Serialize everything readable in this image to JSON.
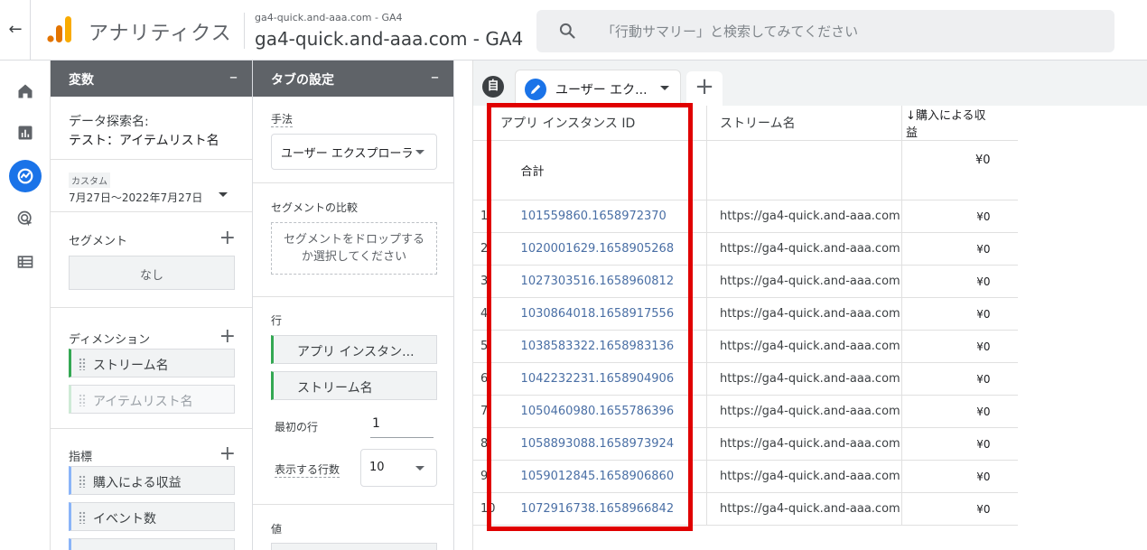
{
  "header": {
    "app_name": "アナリティクス",
    "account_line": "ga4-quick.and-aaa.com - GA4",
    "property_name": "ga4-quick.and-aaa.com - GA4",
    "search_placeholder": "「行動サマリー」と検索してみてください",
    "icons": [
      "back-arrow-icon",
      "analytics-logo",
      "search-icon"
    ]
  },
  "rail": {
    "items": [
      "home-icon",
      "reports-icon",
      "explore-icon",
      "advertising-icon",
      "configure-icon"
    ],
    "active": "explore-icon",
    "accent": "#1a73e8"
  },
  "variables": {
    "title": "変数",
    "collapse": "–",
    "exploration_label": "データ探索名:",
    "exploration_name": "テスト：アイテムリスト名",
    "date_badge": "カスタム",
    "date_range": "7月27日～2022年7月27日",
    "segments_title": "セグメント",
    "segments_empty": "なし",
    "dimensions_title": "ディメンション",
    "dimensions": [
      "ストリーム名",
      "アイテムリスト名"
    ],
    "metrics_title": "指標",
    "metrics": [
      "購入による収益",
      "イベント数"
    ],
    "add": "+"
  },
  "tab_settings": {
    "title": "タブの設定",
    "collapse": "–",
    "technique_label": "手法",
    "technique_value": "ユーザー エクスプローラ",
    "segment_compare_label": "セグメントの比較",
    "segment_drop_text": "セグメントをドロップするか選択してください",
    "rows_label": "行",
    "rows": [
      "アプリ インスタン...",
      "ストリーム名"
    ],
    "first_row_label": "最初の行",
    "first_row_value": "1",
    "rows_shown_label": "表示する行数",
    "rows_shown_value": "10",
    "values_label": "値"
  },
  "tabs": {
    "auto_badge": "自",
    "active_label": "ユーザー エク...",
    "add": "+"
  },
  "table": {
    "columns": [
      "アプリ インスタンス ID",
      "ストリーム名",
      "↓購入による収益"
    ],
    "total_label": "合計",
    "total_revenue": "¥0",
    "rows": [
      {
        "idx": "1",
        "id": "101559860.1658972370",
        "stream": "https://ga4-quick.and-aaa.com",
        "revenue": "¥0"
      },
      {
        "idx": "2",
        "id": "1020001629.1658905268",
        "stream": "https://ga4-quick.and-aaa.com",
        "revenue": "¥0"
      },
      {
        "idx": "3",
        "id": "1027303516.1658960812",
        "stream": "https://ga4-quick.and-aaa.com",
        "revenue": "¥0"
      },
      {
        "idx": "4",
        "id": "1030864018.1658917556",
        "stream": "https://ga4-quick.and-aaa.com",
        "revenue": "¥0"
      },
      {
        "idx": "5",
        "id": "1038583322.1658983136",
        "stream": "https://ga4-quick.and-aaa.com",
        "revenue": "¥0"
      },
      {
        "idx": "6",
        "id": "1042232231.1658904906",
        "stream": "https://ga4-quick.and-aaa.com",
        "revenue": "¥0"
      },
      {
        "idx": "7",
        "id": "1050460980.1655786396",
        "stream": "https://ga4-quick.and-aaa.com",
        "revenue": "¥0"
      },
      {
        "idx": "8",
        "id": "1058893088.1658973924",
        "stream": "https://ga4-quick.and-aaa.com",
        "revenue": "¥0"
      },
      {
        "idx": "9",
        "id": "1059012845.1658906860",
        "stream": "https://ga4-quick.and-aaa.com",
        "revenue": "¥0"
      },
      {
        "idx": "10",
        "id": "1072916738.1658966842",
        "stream": "https://ga4-quick.and-aaa.com",
        "revenue": "¥0"
      }
    ],
    "highlight_color": "#e00000"
  }
}
